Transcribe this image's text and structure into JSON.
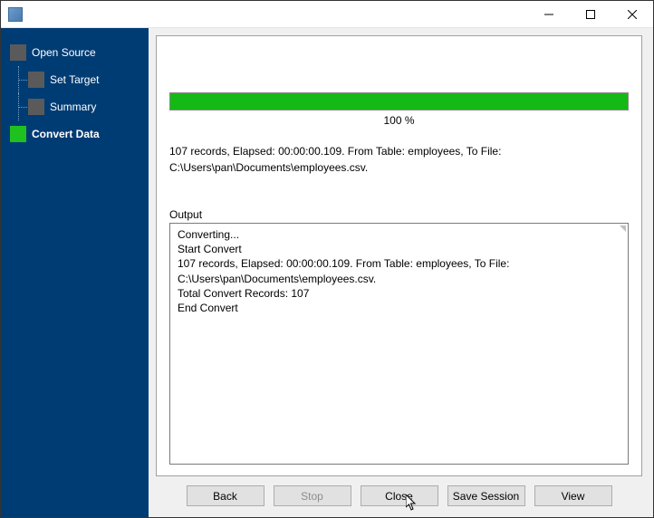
{
  "sidebar": {
    "items": [
      {
        "label": "Open Source",
        "active": false
      },
      {
        "label": "Set Target",
        "active": false
      },
      {
        "label": "Summary",
        "active": false
      },
      {
        "label": "Convert Data",
        "active": true
      }
    ]
  },
  "progress": {
    "percent_label": "100 %",
    "fill_percent": 100
  },
  "status": {
    "line1": "107 records,   Elapsed: 00:00:00.109.   From Table: employees,   To File: C:\\Users\\pan\\Documents\\employees.csv."
  },
  "output": {
    "label": "Output",
    "lines": [
      "Converting...",
      "Start Convert",
      "107 records,   Elapsed: 00:00:00.109.   From Table: employees,   To File: C:\\Users\\pan\\Documents\\employees.csv.",
      "Total Convert Records: 107",
      "End Convert"
    ]
  },
  "buttons": {
    "back": "Back",
    "stop": "Stop",
    "close": "Close",
    "save_session": "Save Session",
    "view": "View"
  }
}
